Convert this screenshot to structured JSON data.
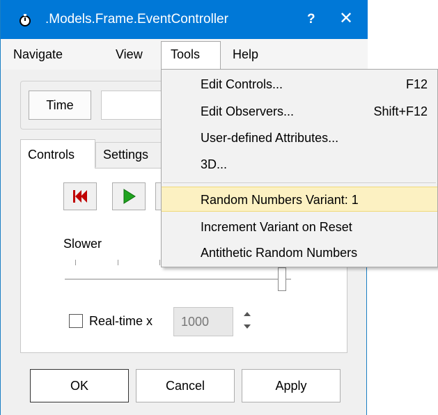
{
  "window": {
    "title": ".Models.Frame.EventController",
    "help_label": "?",
    "close_label": "✕"
  },
  "menubar": {
    "items": [
      {
        "label": "Navigate"
      },
      {
        "label": "View"
      },
      {
        "label": "Tools"
      },
      {
        "label": "Help"
      }
    ]
  },
  "time_button": {
    "label": "Time"
  },
  "tabs": [
    {
      "label": "Controls"
    },
    {
      "label": "Settings"
    }
  ],
  "controls": {
    "slower_label": "Slower",
    "realtime_label": "Real-time x",
    "realtime_value": "1000",
    "realtime_checked": false
  },
  "buttons": {
    "ok": "OK",
    "cancel": "Cancel",
    "apply": "Apply"
  },
  "tools_menu": {
    "items": [
      {
        "label": "Edit Controls...",
        "shortcut": "F12"
      },
      {
        "label": "Edit Observers...",
        "shortcut": "Shift+F12"
      },
      {
        "label": "User-defined Attributes...",
        "shortcut": ""
      },
      {
        "label": "3D...",
        "shortcut": ""
      },
      {
        "label": "Random Numbers Variant:  1",
        "shortcut": ""
      },
      {
        "label": "Increment Variant on Reset",
        "shortcut": ""
      },
      {
        "label": "Antithetic Random Numbers",
        "shortcut": ""
      }
    ],
    "highlighted_index": 4
  },
  "colors": {
    "titlebar": "#0078d7",
    "highlight": "#fcf1c2",
    "reset_icon": "#c00000",
    "play_icon": "#1fa31f"
  },
  "icons": {
    "app": "stopwatch-icon",
    "reset": "rewind-to-start-icon",
    "play": "play-icon"
  }
}
